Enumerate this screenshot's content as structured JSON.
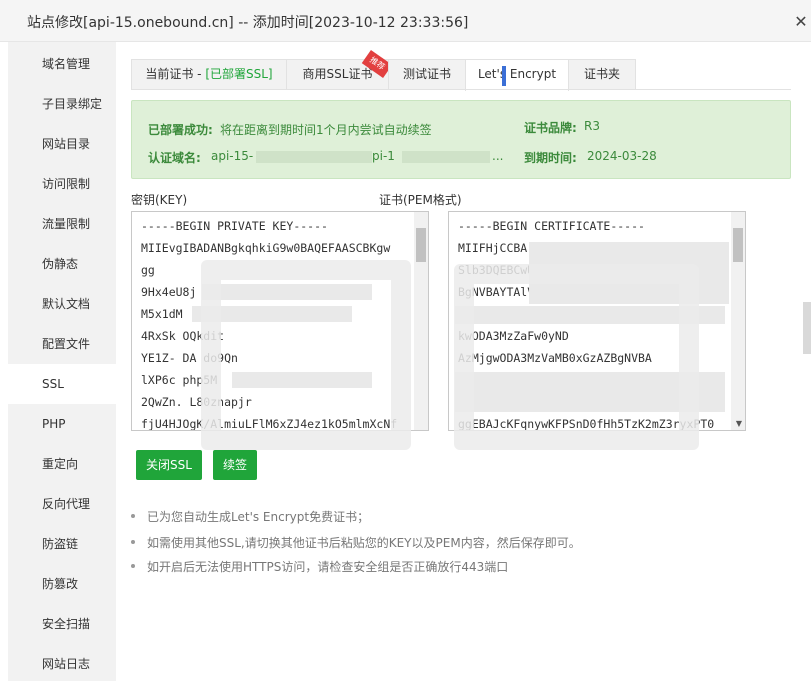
{
  "window": {
    "title": "站点修改[api-15.onebound.cn] -- 添加时间[2023-10-12 23:33:56]",
    "close_glyph": "✕"
  },
  "sidebar": {
    "items": [
      {
        "label": "域名管理"
      },
      {
        "label": "子目录绑定"
      },
      {
        "label": "网站目录"
      },
      {
        "label": "访问限制"
      },
      {
        "label": "流量限制"
      },
      {
        "label": "伪静态"
      },
      {
        "label": "默认文档"
      },
      {
        "label": "配置文件"
      },
      {
        "label": "SSL"
      },
      {
        "label": "PHP"
      },
      {
        "label": "重定向"
      },
      {
        "label": "反向代理"
      },
      {
        "label": "防盗链"
      },
      {
        "label": "防篡改"
      },
      {
        "label": "安全扫描"
      },
      {
        "label": "网站日志"
      }
    ],
    "active": "SSL"
  },
  "tabs": {
    "current_cert_prefix": "当前证书 - ",
    "current_cert_status": "[已部署SSL]",
    "commercial": "商用SSL证书",
    "commercial_badge": "推荐",
    "test": "测试证书",
    "letsencrypt": "Let's Encrypt",
    "folder": "证书夹",
    "active": "Let's Encrypt"
  },
  "status": {
    "deployed_label": "已部署成功:",
    "deployed_text": "将在距离到期时间1个月内尝试自动续签",
    "domain_label": "认证域名:",
    "domain_prefix": "api-15-",
    "domain_mid": "pi-1",
    "domain_suffix": "...",
    "brand_label": "证书品牌:",
    "brand_value": "R3",
    "expire_label": "到期时间:",
    "expire_value": "2024-03-28"
  },
  "key_section": {
    "label": "密钥(KEY)",
    "lines": [
      "-----BEGIN PRIVATE KEY-----",
      "MIIEvgIBADANBgkqhkiG9w0BAQEFAASCBKgw",
      "gg",
      "9Hx4eU8j",
      "M5x1dM",
      "4RxSk          OQkdit",
      "YE1Z-    DA      do9Qn",
      "lXP6c    php5M",
      "2QwZn.              L80znapjr",
      "fjU4HJOgK/AlmiuLFlM6xZJ4ez1kO5mlmXcNf"
    ]
  },
  "cert_section": {
    "label": "证书(PEM格式)",
    "lines": [
      "-----BEGIN CERTIFICATE-----",
      "MIIFHjCCBA",
      "                        Slb3DQEBCwUA",
      "                         BgNVBAYTAlVTMRYwFAYD",
      "                              kwODA3MzZaFw0yND",
      "AzMjgwODA3MzVaMB0xGzAZBgNVBA",
      "",
      "",
      "",
      "ggEBAJcKFqnywKFPSnD0fHh5TzK2mZ3ryxPT0"
    ]
  },
  "buttons": {
    "close_ssl": "关闭SSL",
    "renew": "续签"
  },
  "tips": [
    "已为您自动生成Let's Encrypt免费证书；",
    "如需使用其他SSL,请切换其他证书后粘贴您的KEY以及PEM内容，然后保存即可。",
    "如开启后无法使用HTTPS访问，请检查安全组是否正确放行443端口"
  ]
}
